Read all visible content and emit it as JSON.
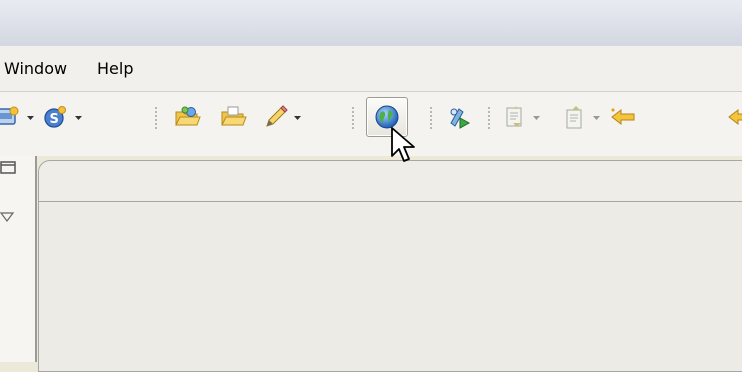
{
  "menu": {
    "items": [
      {
        "label": "Window"
      },
      {
        "label": "Help"
      }
    ]
  },
  "toolbar": {
    "buttons": [
      {
        "icon": "new-wizard-icon"
      },
      {
        "icon": "new-service-icon"
      },
      {
        "icon": "open-project-icon"
      },
      {
        "icon": "open-folder-icon"
      },
      {
        "icon": "edit-pencil-icon"
      },
      {
        "icon": "globe-icon",
        "state": "pressed"
      },
      {
        "icon": "run-deploy-icon"
      },
      {
        "icon": "next-annotation-icon"
      },
      {
        "icon": "previous-annotation-icon"
      },
      {
        "icon": "last-edit-icon"
      },
      {
        "icon": "back-icon"
      }
    ]
  },
  "colors": {
    "background": "#ece9d8",
    "menubar": "#f1f0ec",
    "toolbar": "#f4f3ef",
    "editor": "#ecebe6",
    "border": "#a6a6a2"
  }
}
